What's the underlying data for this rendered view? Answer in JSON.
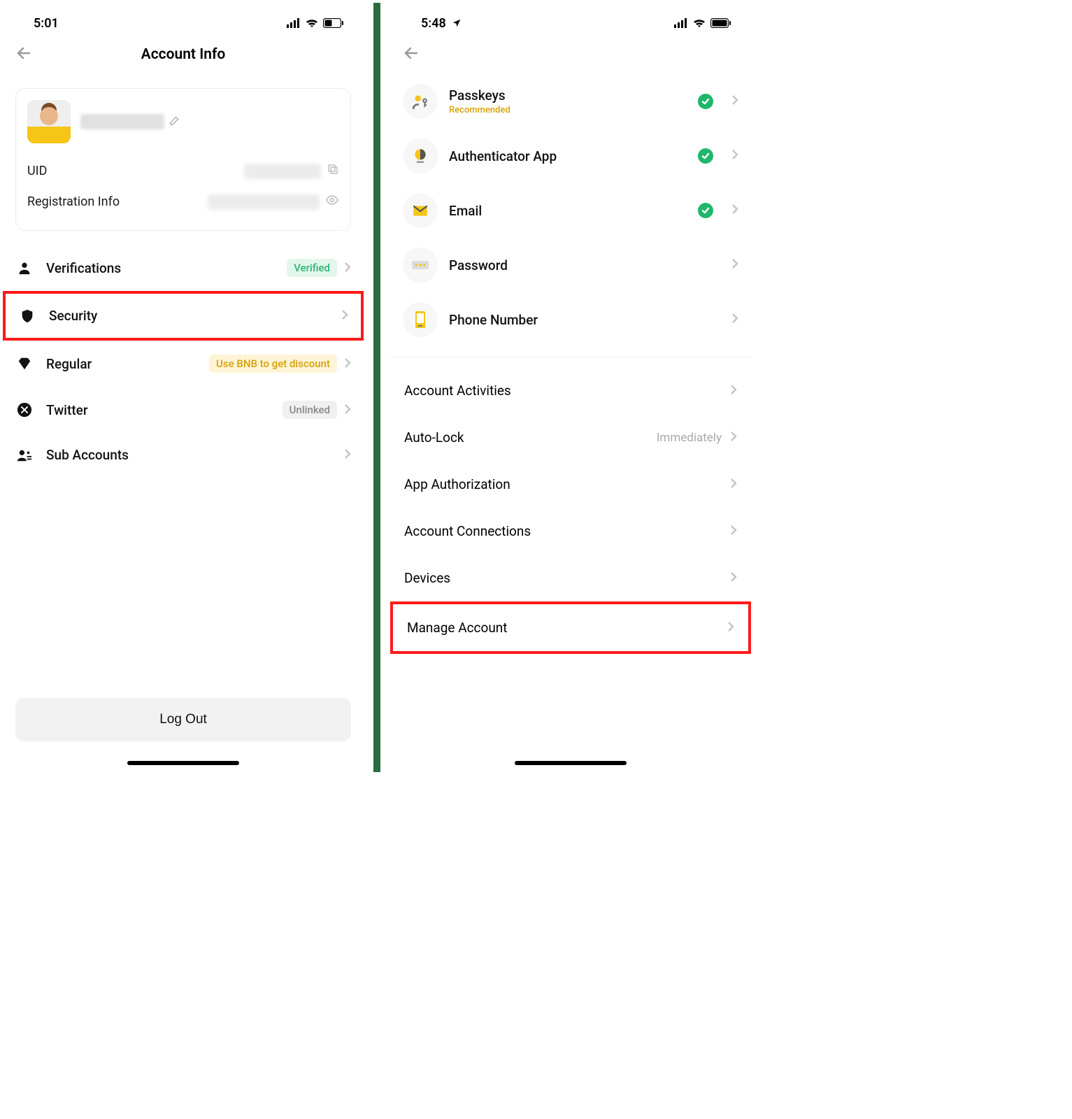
{
  "left": {
    "status": {
      "time": "5:01"
    },
    "title": "Account Info",
    "card": {
      "uid_label": "UID",
      "reg_label": "Registration Info"
    },
    "rows": {
      "verifications": {
        "label": "Verifications",
        "badge": "Verified"
      },
      "security": {
        "label": "Security"
      },
      "regular": {
        "label": "Regular",
        "badge": "Use BNB to get discount"
      },
      "twitter": {
        "label": "Twitter",
        "badge": "Unlinked"
      },
      "sub_accounts": {
        "label": "Sub Accounts"
      }
    },
    "logout": "Log Out"
  },
  "right": {
    "status": {
      "time": "5:48"
    },
    "security_items": {
      "passkeys": {
        "title": "Passkeys",
        "rec": "Recommended",
        "checked": true
      },
      "authenticator": {
        "title": "Authenticator App",
        "checked": true
      },
      "email": {
        "title": "Email",
        "checked": true
      },
      "password": {
        "title": "Password",
        "checked": false
      },
      "phone": {
        "title": "Phone Number",
        "checked": false
      }
    },
    "plain": {
      "activities": "Account Activities",
      "autolock": {
        "label": "Auto-Lock",
        "value": "Immediately"
      },
      "app_auth": "App Authorization",
      "connections": "Account Connections",
      "devices": "Devices",
      "manage": "Manage Account"
    }
  }
}
